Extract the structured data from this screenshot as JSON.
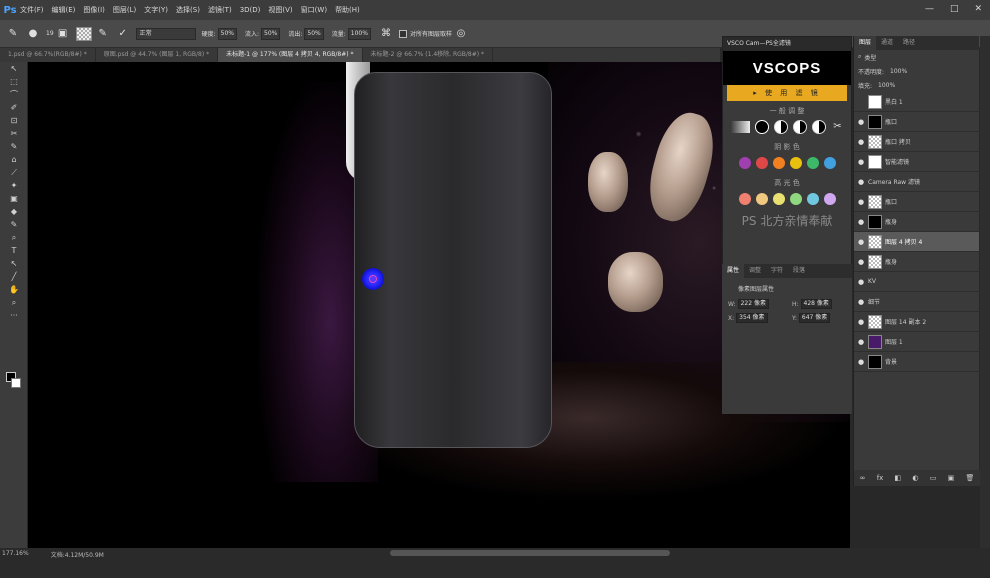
{
  "app": {
    "logo": "Ps"
  },
  "menu": [
    "文件(F)",
    "编辑(E)",
    "图像(I)",
    "图层(L)",
    "文字(Y)",
    "选择(S)",
    "滤镜(T)",
    "3D(D)",
    "视图(V)",
    "窗口(W)",
    "帮助(H)"
  ],
  "window_controls": [
    "—",
    "□",
    "✕"
  ],
  "options": {
    "brush_size": "19",
    "mode": "正常",
    "opacity_label": "硬度:",
    "opacity_value": "50%",
    "flow_label": "流入:",
    "flow_value": "50%",
    "flow2_label": "流出:",
    "flow2_value": "50%",
    "strength_label": "流量:",
    "strength_value": "100%",
    "sample_all_label": "对所有图层取样"
  },
  "tabs": [
    {
      "label": "1.psd @ 66.7%(RGB/8#) *",
      "active": false
    },
    {
      "label": "原图.psd @ 44.7% (图层 1, RGB/8) *",
      "active": false
    },
    {
      "label": "未标题-1 @ 177% (图层 4 拷贝 4, RGB/8#) *",
      "active": true
    },
    {
      "label": "未标题-2 @ 66.7% (1.4移除, RGB/8#) *",
      "active": false
    }
  ],
  "tools": [
    "↖",
    "⬚",
    "⌒",
    "✐",
    "⊡",
    "✂",
    "✎",
    "⌂",
    "⟋",
    "✦",
    "▣",
    "◆",
    "✎",
    "⌕",
    "T",
    "↖",
    "╱",
    "✋",
    "⌕",
    "···"
  ],
  "vsco": {
    "header": "VSCO Cam—PS全滤镜",
    "logo": "VSCOPS",
    "use_button": "▸ 使 用 滤 镜",
    "section_general": "一 般 调 整",
    "section_shadow": "阴 影 色",
    "section_highlight": "高 光 色",
    "watermark": "PS 北方亲情奉献",
    "shadow_colors": [
      "#a040b0",
      "#e04848",
      "#f08020",
      "#e8c010",
      "#3cb868",
      "#40a0e0"
    ],
    "highlight_colors": [
      "#f08070",
      "#f0c880",
      "#e8e070",
      "#90d880",
      "#70c8e0",
      "#d0a8f0"
    ]
  },
  "properties": {
    "tabs": [
      "属性",
      "调整",
      "字符",
      "段落"
    ],
    "title": "像素图层属性",
    "w_label": "W:",
    "w_value": "222 像素",
    "h_label": "H:",
    "h_value": "428 像素",
    "x_label": "X:",
    "x_value": "354 像素",
    "y_label": "Y:",
    "y_value": "647 像素"
  },
  "layers": {
    "tabs": [
      "图层",
      "通道",
      "路径"
    ],
    "filter": "类型",
    "opacity_label": "不透明度:",
    "opacity_value": "100%",
    "fill_label": "填充:",
    "fill_value": "100%",
    "items": [
      {
        "name": "黑白 1",
        "thumb": "white",
        "eye": "",
        "selected": false
      },
      {
        "name": "瓶口",
        "thumb": "black",
        "eye": "●",
        "selected": false
      },
      {
        "name": "瓶口 拷贝",
        "thumb": "check",
        "eye": "●",
        "selected": false
      },
      {
        "name": "智能滤镜",
        "thumb": "white",
        "eye": "●",
        "selected": false
      },
      {
        "name": "Camera Raw 滤镜",
        "thumb": "",
        "eye": "●",
        "selected": false
      },
      {
        "name": "瓶口",
        "thumb": "check",
        "eye": "●",
        "selected": false
      },
      {
        "name": "瓶身",
        "thumb": "black",
        "eye": "●",
        "selected": false
      },
      {
        "name": "图层 4 拷贝 4",
        "thumb": "check",
        "eye": "●",
        "selected": true
      },
      {
        "name": "瓶身",
        "thumb": "check",
        "eye": "●",
        "selected": false
      },
      {
        "name": "KV",
        "thumb": "",
        "eye": "●",
        "selected": false
      },
      {
        "name": "细节",
        "thumb": "",
        "eye": "●",
        "selected": false
      },
      {
        "name": "图层 14 副本 2",
        "thumb": "check",
        "eye": "●",
        "selected": false
      },
      {
        "name": "图层 1",
        "thumb": "purple",
        "eye": "●",
        "selected": false
      },
      {
        "name": "背景",
        "thumb": "black",
        "eye": "●",
        "selected": false
      }
    ],
    "footer": [
      "∞",
      "fx",
      "◧",
      "◐",
      "▭",
      "▣",
      "🗑"
    ]
  },
  "status": {
    "zoom": "177.16%",
    "doc": "文档:4.12M/50.9M"
  }
}
